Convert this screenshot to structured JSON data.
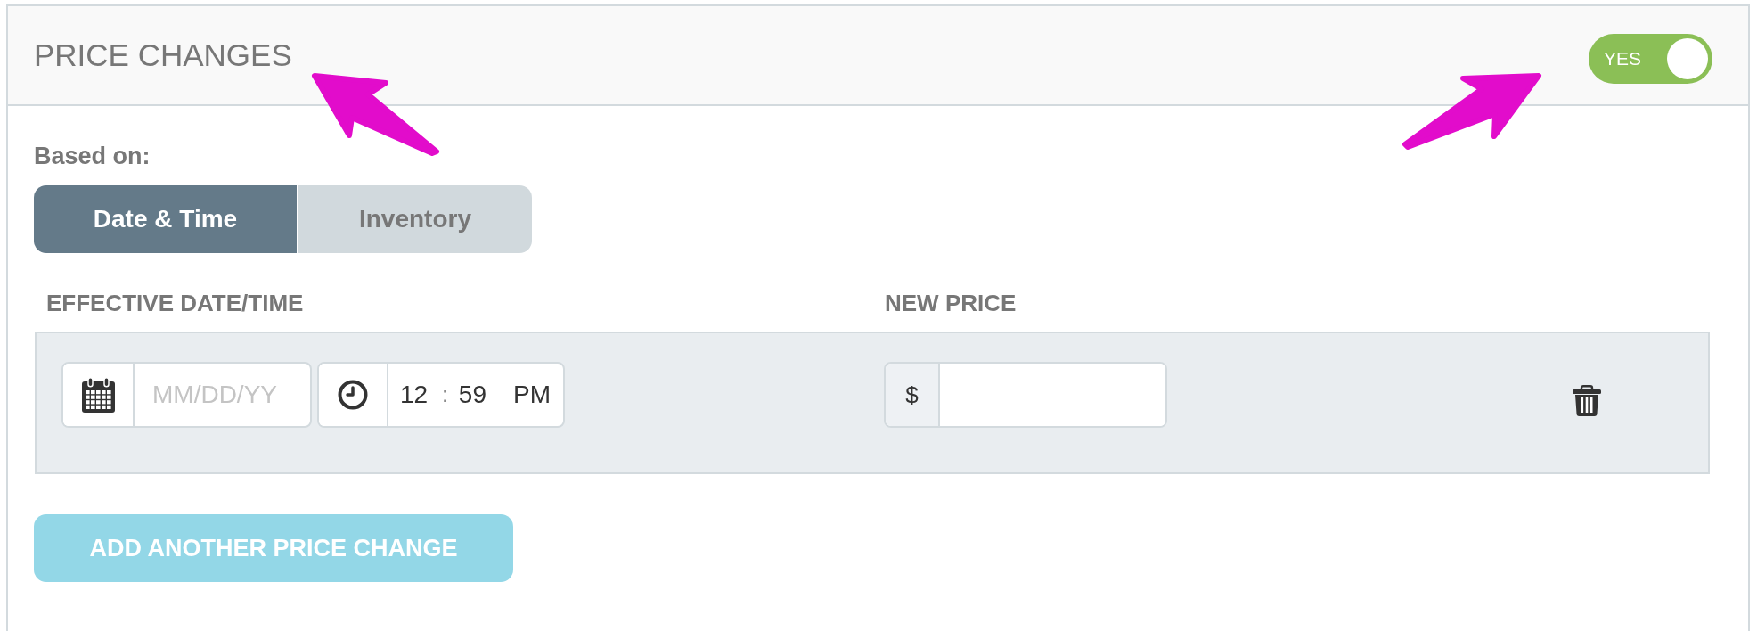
{
  "section": {
    "title": "PRICE CHANGES",
    "toggle": {
      "label": "YES",
      "on": true
    }
  },
  "based_on": {
    "label": "Based on:",
    "tabs": [
      {
        "label": "Date & Time",
        "selected": true
      },
      {
        "label": "Inventory",
        "selected": false
      }
    ]
  },
  "columns": [
    "EFFECTIVE DATE/TIME",
    "NEW PRICE"
  ],
  "rows": [
    {
      "date": {
        "placeholder": "MM/DD/YY"
      },
      "time": {
        "hours": "12",
        "separator": ":",
        "minutes": "59",
        "meridiem": "PM"
      },
      "price": {
        "currency": "$"
      }
    }
  ],
  "add_button": {
    "label": "ADD ANOTHER PRICE CHANGE",
    "disabled": true
  },
  "callout_arrows": [
    {
      "kind": "upleft"
    },
    {
      "kind": "upright"
    }
  ]
}
